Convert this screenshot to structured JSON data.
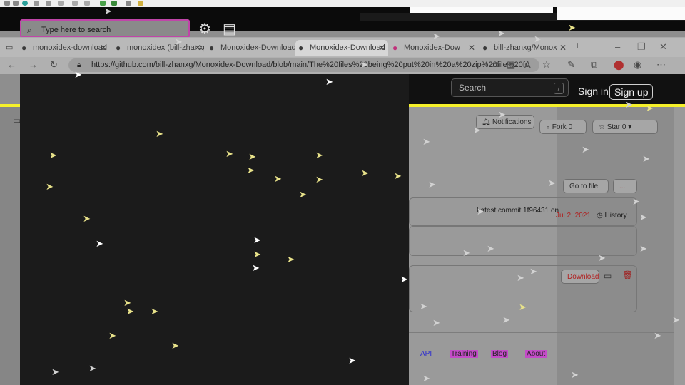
{
  "window": {
    "search_placeholder": "Type here to search"
  },
  "tabs": [
    {
      "label": "monoxidex-download",
      "icon": "github-icon"
    },
    {
      "label": "monoxidex (bill-zhanxg)",
      "icon": "github-icon"
    },
    {
      "label": "Monoxidex-Download",
      "icon": "github-icon"
    },
    {
      "label": "Monoxidex-Download",
      "icon": "github-icon",
      "active": true
    },
    {
      "label": "Monoxidex-Dow",
      "icon": "chrome-icon"
    },
    {
      "label": "bill-zhanxg/Monox",
      "icon": "github-icon"
    }
  ],
  "address": {
    "url": "https://github.com/bill-zhanxg/Monoxidex-Download/blob/main/The%20files%20being%20put%20in%20a%20zip%20file%20fo"
  },
  "github": {
    "search_label": "Search",
    "search_shortcut": "/",
    "sign_in": "Sign in",
    "sign_up": "Sign up",
    "notifications_label": "Notifications",
    "fork_label": "Fork",
    "fork_count": "0",
    "star_label": "Star",
    "star_count": "0",
    "go_to_file": "Go to file",
    "more_label": "...",
    "latest_commit_label": "Latest commit",
    "latest_commit_hash": "1f96431",
    "latest_commit_on": "on",
    "latest_commit_date": "Jul 2, 2021",
    "history_label": "History",
    "download_label": "Download",
    "footer_links": [
      {
        "label": "API"
      },
      {
        "label": "Training"
      },
      {
        "label": "Blog"
      },
      {
        "label": "About"
      }
    ]
  }
}
